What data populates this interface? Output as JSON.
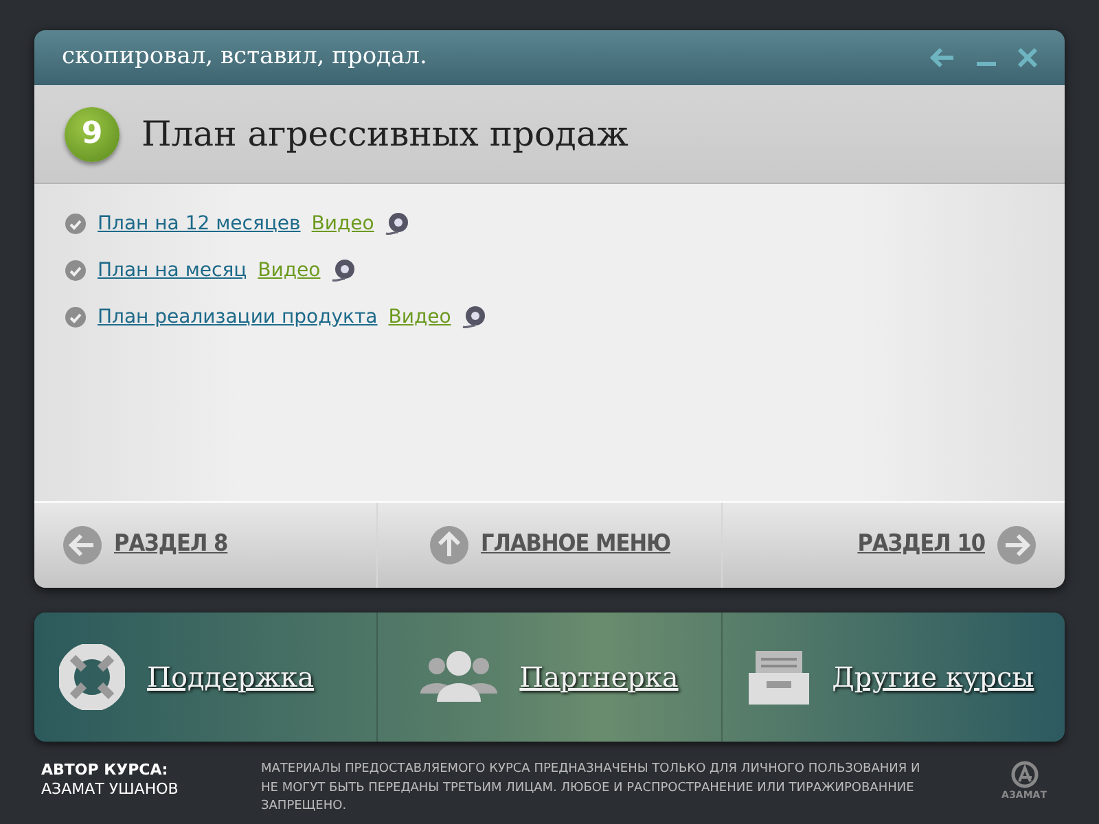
{
  "window": {
    "title": "скопировал, вставил, продал."
  },
  "section": {
    "number": "9",
    "title": "План агрессивных продаж"
  },
  "lessons": [
    {
      "title": "План на 12 месяцев",
      "video": "Видео"
    },
    {
      "title": "План на месяц",
      "video": "Видео"
    },
    {
      "title": "План реализации продукта",
      "video": "Видео"
    }
  ],
  "navigation": {
    "previous": "РАЗДЕЛ 8",
    "main_menu": "ГЛАВНОЕ МЕНЮ",
    "next": "РАЗДЕЛ 10"
  },
  "bottom_menu": [
    {
      "kind": "support",
      "label": "Поддержка"
    },
    {
      "kind": "partner",
      "label": "Партнерка"
    },
    {
      "kind": "courses",
      "label": "Другие курсы"
    }
  ],
  "footer": {
    "author_label": "АВТОР КУРСА:",
    "author_name": "АЗАМАТ УШАНОВ",
    "notice": "МАТЕРИАЛЫ ПРЕДОСТАВЛЯЕМОГО КУРСА ПРЕДНАЗНАЧЕНЫ ТОЛЬКО ДЛЯ ЛИЧНОГО ПОЛЬЗОВАНИЯ И НЕ МОГУТ БЫТЬ ПЕРЕДАНЫ ТРЕТЬИМ ЛИЦАМ. ЛЮБОЕ И РАСПРОСТРАНЕНИЕ ИЛИ ТИРАЖИРОВАННИЕ ЗАПРЕЩЕНО.",
    "logo_text": "АЗАМАТ"
  }
}
